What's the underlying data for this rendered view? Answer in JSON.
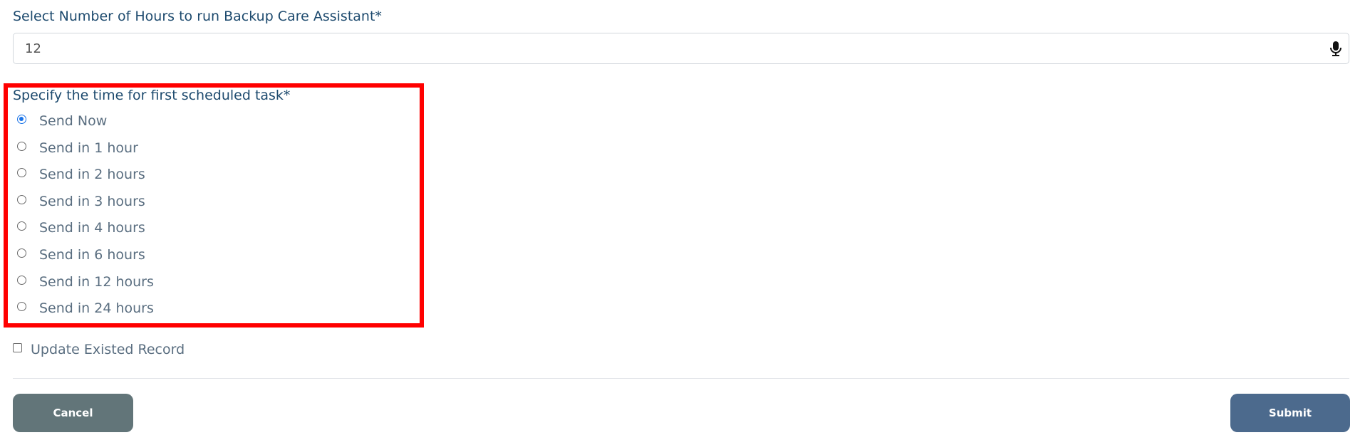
{
  "hours_field": {
    "label": "Select Number of Hours to run Backup Care Assistant*",
    "value": "12",
    "icon": "microphone-icon"
  },
  "schedule": {
    "label": "Specify the time for first scheduled task*",
    "selected_index": 0,
    "options": [
      {
        "label": "Send Now",
        "checked": true
      },
      {
        "label": "Send in 1 hour",
        "checked": false
      },
      {
        "label": "Send in 2 hours",
        "checked": false
      },
      {
        "label": "Send in 3 hours",
        "checked": false
      },
      {
        "label": "Send in 4 hours",
        "checked": false
      },
      {
        "label": "Send in 6 hours",
        "checked": false
      },
      {
        "label": "Send in 12 hours",
        "checked": false
      },
      {
        "label": "Send in 24 hours",
        "checked": false
      }
    ]
  },
  "update_record": {
    "label": "Update Existed Record",
    "checked": false
  },
  "actions": {
    "cancel_label": "Cancel",
    "submit_label": "Submit"
  },
  "colors": {
    "label_text": "#1d4a6e",
    "option_text": "#5a6e80",
    "highlight_border": "#ff0000",
    "cancel_button": "#627579",
    "submit_button": "#4c6a8d",
    "radio_checked": "#1a73e8"
  }
}
